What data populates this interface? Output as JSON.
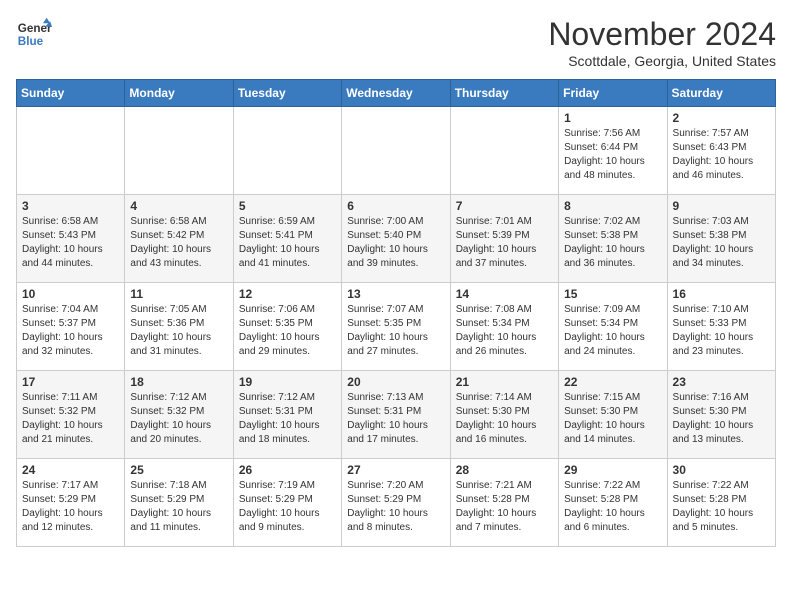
{
  "header": {
    "logo_line1": "General",
    "logo_line2": "Blue",
    "month": "November 2024",
    "location": "Scottdale, Georgia, United States"
  },
  "weekdays": [
    "Sunday",
    "Monday",
    "Tuesday",
    "Wednesday",
    "Thursday",
    "Friday",
    "Saturday"
  ],
  "weeks": [
    [
      null,
      null,
      null,
      null,
      null,
      {
        "day": 1,
        "sunrise": "7:56 AM",
        "sunset": "6:44 PM",
        "daylight": "10 hours and 48 minutes."
      },
      {
        "day": 2,
        "sunrise": "7:57 AM",
        "sunset": "6:43 PM",
        "daylight": "10 hours and 46 minutes."
      }
    ],
    [
      {
        "day": 3,
        "sunrise": "6:58 AM",
        "sunset": "5:43 PM",
        "daylight": "10 hours and 44 minutes."
      },
      {
        "day": 4,
        "sunrise": "6:58 AM",
        "sunset": "5:42 PM",
        "daylight": "10 hours and 43 minutes."
      },
      {
        "day": 5,
        "sunrise": "6:59 AM",
        "sunset": "5:41 PM",
        "daylight": "10 hours and 41 minutes."
      },
      {
        "day": 6,
        "sunrise": "7:00 AM",
        "sunset": "5:40 PM",
        "daylight": "10 hours and 39 minutes."
      },
      {
        "day": 7,
        "sunrise": "7:01 AM",
        "sunset": "5:39 PM",
        "daylight": "10 hours and 37 minutes."
      },
      {
        "day": 8,
        "sunrise": "7:02 AM",
        "sunset": "5:38 PM",
        "daylight": "10 hours and 36 minutes."
      },
      {
        "day": 9,
        "sunrise": "7:03 AM",
        "sunset": "5:38 PM",
        "daylight": "10 hours and 34 minutes."
      }
    ],
    [
      {
        "day": 10,
        "sunrise": "7:04 AM",
        "sunset": "5:37 PM",
        "daylight": "10 hours and 32 minutes."
      },
      {
        "day": 11,
        "sunrise": "7:05 AM",
        "sunset": "5:36 PM",
        "daylight": "10 hours and 31 minutes."
      },
      {
        "day": 12,
        "sunrise": "7:06 AM",
        "sunset": "5:35 PM",
        "daylight": "10 hours and 29 minutes."
      },
      {
        "day": 13,
        "sunrise": "7:07 AM",
        "sunset": "5:35 PM",
        "daylight": "10 hours and 27 minutes."
      },
      {
        "day": 14,
        "sunrise": "7:08 AM",
        "sunset": "5:34 PM",
        "daylight": "10 hours and 26 minutes."
      },
      {
        "day": 15,
        "sunrise": "7:09 AM",
        "sunset": "5:34 PM",
        "daylight": "10 hours and 24 minutes."
      },
      {
        "day": 16,
        "sunrise": "7:10 AM",
        "sunset": "5:33 PM",
        "daylight": "10 hours and 23 minutes."
      }
    ],
    [
      {
        "day": 17,
        "sunrise": "7:11 AM",
        "sunset": "5:32 PM",
        "daylight": "10 hours and 21 minutes."
      },
      {
        "day": 18,
        "sunrise": "7:12 AM",
        "sunset": "5:32 PM",
        "daylight": "10 hours and 20 minutes."
      },
      {
        "day": 19,
        "sunrise": "7:12 AM",
        "sunset": "5:31 PM",
        "daylight": "10 hours and 18 minutes."
      },
      {
        "day": 20,
        "sunrise": "7:13 AM",
        "sunset": "5:31 PM",
        "daylight": "10 hours and 17 minutes."
      },
      {
        "day": 21,
        "sunrise": "7:14 AM",
        "sunset": "5:30 PM",
        "daylight": "10 hours and 16 minutes."
      },
      {
        "day": 22,
        "sunrise": "7:15 AM",
        "sunset": "5:30 PM",
        "daylight": "10 hours and 14 minutes."
      },
      {
        "day": 23,
        "sunrise": "7:16 AM",
        "sunset": "5:30 PM",
        "daylight": "10 hours and 13 minutes."
      }
    ],
    [
      {
        "day": 24,
        "sunrise": "7:17 AM",
        "sunset": "5:29 PM",
        "daylight": "10 hours and 12 minutes."
      },
      {
        "day": 25,
        "sunrise": "7:18 AM",
        "sunset": "5:29 PM",
        "daylight": "10 hours and 11 minutes."
      },
      {
        "day": 26,
        "sunrise": "7:19 AM",
        "sunset": "5:29 PM",
        "daylight": "10 hours and 9 minutes."
      },
      {
        "day": 27,
        "sunrise": "7:20 AM",
        "sunset": "5:29 PM",
        "daylight": "10 hours and 8 minutes."
      },
      {
        "day": 28,
        "sunrise": "7:21 AM",
        "sunset": "5:28 PM",
        "daylight": "10 hours and 7 minutes."
      },
      {
        "day": 29,
        "sunrise": "7:22 AM",
        "sunset": "5:28 PM",
        "daylight": "10 hours and 6 minutes."
      },
      {
        "day": 30,
        "sunrise": "7:22 AM",
        "sunset": "5:28 PM",
        "daylight": "10 hours and 5 minutes."
      }
    ]
  ]
}
